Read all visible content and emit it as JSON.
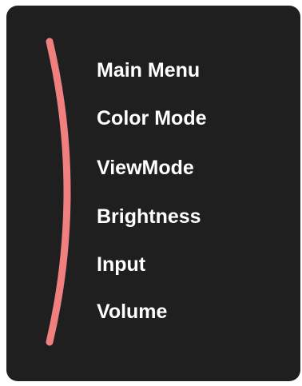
{
  "menu": {
    "items": [
      {
        "label": "Main Menu"
      },
      {
        "label": "Color Mode"
      },
      {
        "label": "ViewMode"
      },
      {
        "label": "Brightness"
      },
      {
        "label": "Input"
      },
      {
        "label": "Volume"
      }
    ]
  },
  "colors": {
    "panel": "#1f1f1f",
    "arc": "#f08080",
    "text": "#ffffff"
  }
}
